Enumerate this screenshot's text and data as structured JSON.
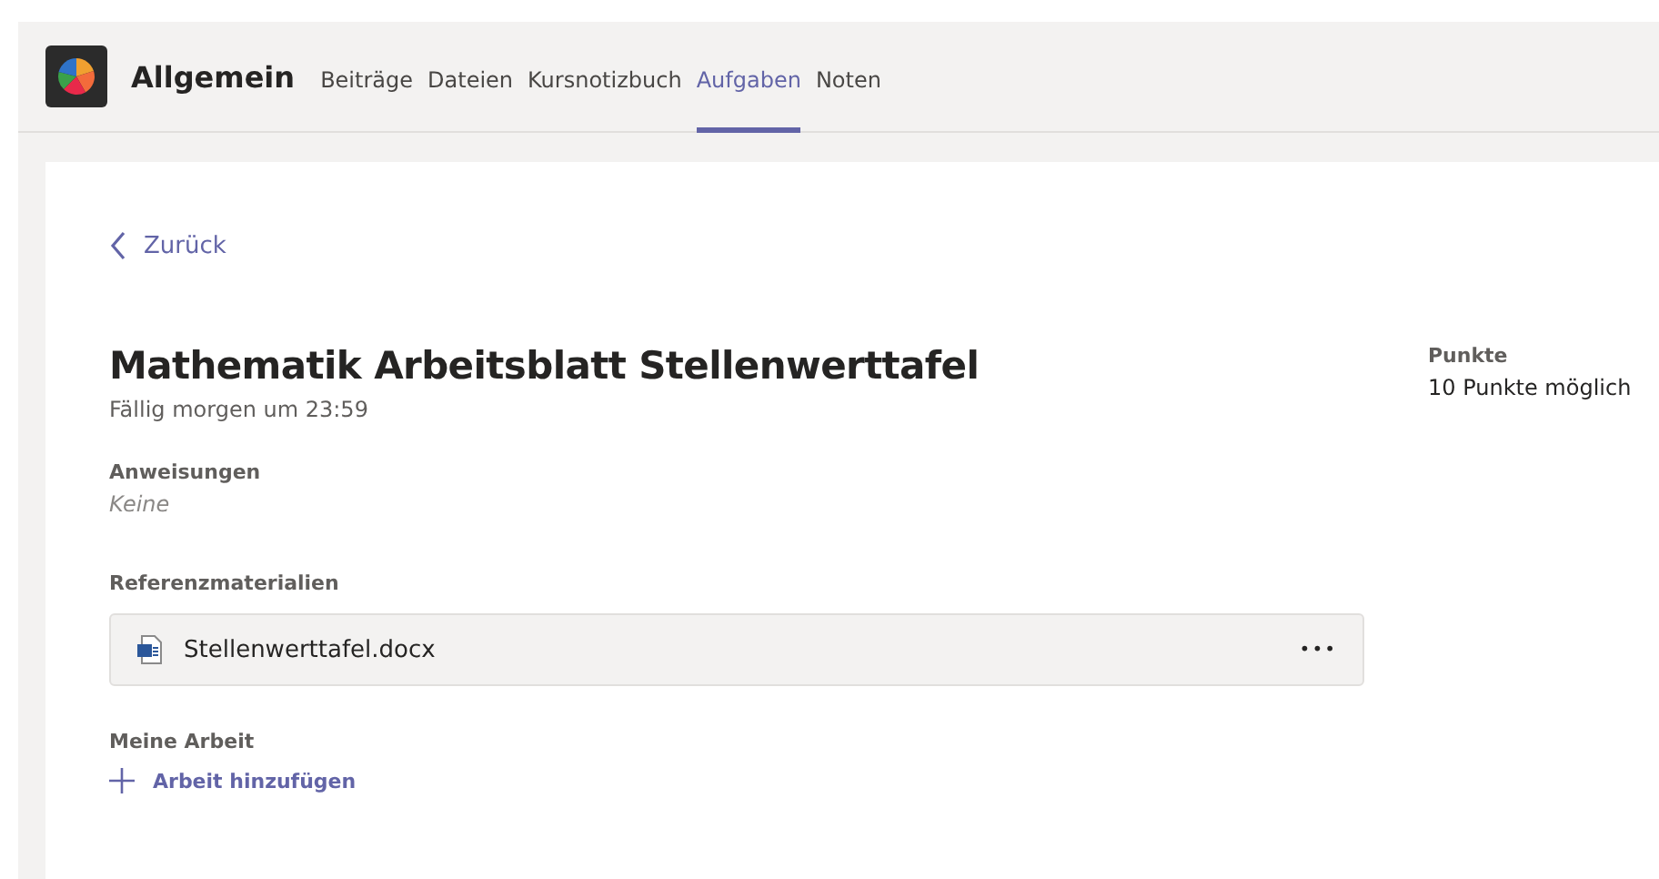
{
  "header": {
    "channel": "Allgemein",
    "tabs": [
      {
        "label": "Beiträge",
        "selected": false
      },
      {
        "label": "Dateien",
        "selected": false
      },
      {
        "label": "Kursnotizbuch",
        "selected": false
      },
      {
        "label": "Aufgaben",
        "selected": true
      },
      {
        "label": "Noten",
        "selected": false
      }
    ]
  },
  "back": "Zurück",
  "assignment": {
    "title": "Mathematik Arbeitsblatt Stellenwerttafel",
    "due": "Fällig morgen um 23:59",
    "instructions_label": "Anweisungen",
    "instructions": "Keine",
    "reference_label": "Referenzmaterialien",
    "files": [
      {
        "name": "Stellenwerttafel.docx",
        "more": "•••"
      }
    ],
    "my_work_label": "Meine Arbeit",
    "add_work": "Arbeit hinzufügen"
  },
  "points": {
    "label": "Punkte",
    "value": "10 Punkte möglich"
  }
}
